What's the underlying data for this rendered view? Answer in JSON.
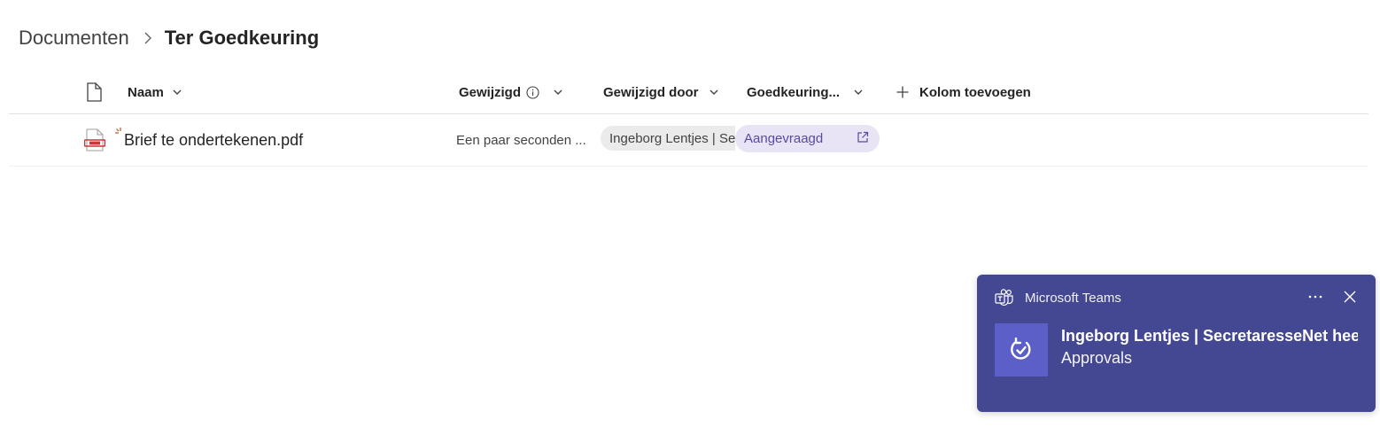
{
  "breadcrumb": {
    "parent": "Documenten",
    "current": "Ter Goedkeuring"
  },
  "columns": {
    "filetype_icon": "document-icon",
    "name": "Naam",
    "modified": "Gewijzigd",
    "modified_by": "Gewijzigd door",
    "approval": "Goedkeuring...",
    "add_column": "Kolom toevoegen"
  },
  "rows": [
    {
      "file_icon": "pdf-file-icon",
      "name": "Brief te ondertekenen.pdf",
      "modified": "Een paar seconden ...",
      "modified_by": "Ingeborg Lentjes | SecretaresseNet",
      "approval_status": "Aangevraagd"
    }
  ],
  "toast": {
    "app_name": "Microsoft Teams",
    "title": "Ingeborg Lentjes | SecretaresseNet heeft...",
    "subtitle": "Approvals"
  },
  "colors": {
    "toast_bg": "#444791",
    "toast_thumb": "#5b5fc7",
    "status_pill_bg": "#e8e3f5",
    "status_pill_text": "#5b4aa0",
    "pdf_red": "#d13438"
  }
}
